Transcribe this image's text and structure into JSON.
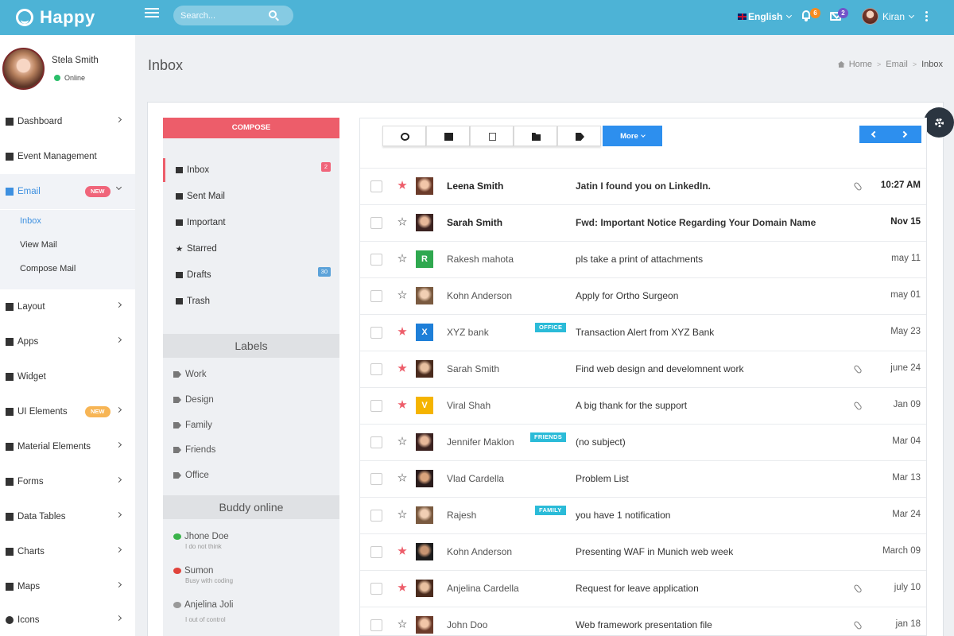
{
  "brand": {
    "name": "Happy"
  },
  "topbar": {
    "search_placeholder": "Search...",
    "language": "English",
    "notif_count": "6",
    "mail_count": "2",
    "user_name": "Kiran"
  },
  "profile": {
    "name": "Stela Smith",
    "status": "Online"
  },
  "nav": {
    "dashboard": "Dashboard",
    "event": "Event Management",
    "email": "Email",
    "email_badge": "NEW",
    "inbox": "Inbox",
    "view_mail": "View Mail",
    "compose_mail": "Compose Mail",
    "layout": "Layout",
    "apps": "Apps",
    "widget": "Widget",
    "ui_elements": "UI Elements",
    "ui_badge": "NEW",
    "material": "Material Elements",
    "forms": "Forms",
    "data_tables": "Data Tables",
    "charts": "Charts",
    "maps": "Maps",
    "icons": "Icons"
  },
  "page": {
    "title": "Inbox",
    "breadcrumb": [
      "Home",
      "Email",
      "Inbox"
    ]
  },
  "mailbox": {
    "compose": "COMPOSE",
    "folders": [
      {
        "label": "Inbox",
        "count": "2"
      },
      {
        "label": "Sent Mail"
      },
      {
        "label": "Important"
      },
      {
        "label": "Starred"
      },
      {
        "label": "Drafts",
        "count": "30"
      },
      {
        "label": "Trash"
      }
    ],
    "labels_title": "Labels",
    "labels": [
      "Work",
      "Design",
      "Family",
      "Friends",
      "Office"
    ],
    "buddy_title": "Buddy online",
    "buddies": [
      {
        "name": "Jhone Doe",
        "status": "I do not think"
      },
      {
        "name": "Sumon",
        "status": "Busy with coding"
      },
      {
        "name": "Anjelina Joli",
        "status": "I out of control"
      }
    ],
    "more": "More"
  },
  "colors": {
    "accent": "#4db3d6",
    "compose": "#ed5d6a",
    "primary": "#2d8fee",
    "tag": "#2bbbd8"
  },
  "emails": [
    {
      "sender": "Leena Smith",
      "subject": "Jatin I found you on LinkedIn.",
      "time": "10:27 AM",
      "starred": true,
      "attach": true,
      "unread": true
    },
    {
      "sender": "Sarah Smith",
      "subject": "Fwd: Important Notice Regarding Your Domain Name",
      "time": "Nov 15",
      "starred": false,
      "unread": true
    },
    {
      "sender": "Rakesh mahota",
      "subject": "pls take a print of attachments",
      "time": "may 11",
      "starred": false,
      "avatar_letter": "R"
    },
    {
      "sender": "Kohn Anderson",
      "subject": "Apply for Ortho Surgeon",
      "time": "may 01",
      "starred": false
    },
    {
      "sender": "XYZ bank",
      "subject": "Transaction Alert from XYZ Bank",
      "time": "May 23",
      "starred": true,
      "tag": "OFFICE",
      "avatar_letter": "X"
    },
    {
      "sender": "Sarah Smith",
      "subject": "Find web design and develomnent work",
      "time": "june 24",
      "starred": true,
      "attach": true
    },
    {
      "sender": "Viral Shah",
      "subject": "A big thank for the support",
      "time": "Jan 09",
      "starred": true,
      "attach": true,
      "avatar_letter": "V"
    },
    {
      "sender": "Jennifer Maklon",
      "subject": "(no subject)",
      "time": "Mar 04",
      "starred": false,
      "tag": "FRIENDS"
    },
    {
      "sender": "Vlad Cardella",
      "subject": "Problem List",
      "time": "Mar 13",
      "starred": false
    },
    {
      "sender": "Rajesh",
      "subject": "you have 1 notification",
      "time": "Mar 24",
      "starred": false,
      "tag": "FAMILY"
    },
    {
      "sender": "Kohn Anderson",
      "subject": "Presenting WAF in Munich web week",
      "time": "March 09",
      "starred": true
    },
    {
      "sender": "Anjelina Cardella",
      "subject": "Request for leave application",
      "time": "july 10",
      "starred": true,
      "attach": true
    },
    {
      "sender": "John Doo",
      "subject": "Web framework presentation file",
      "time": "jan 18",
      "starred": false,
      "attach": true
    }
  ]
}
